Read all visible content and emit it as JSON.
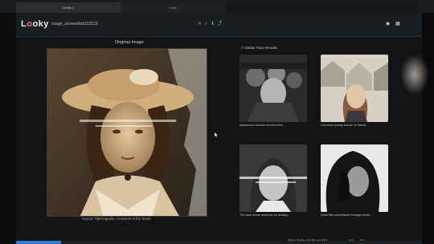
{
  "tabs": [
    {
      "label": "Detail 1"
    },
    {
      "label": "Links"
    }
  ],
  "app": {
    "logo_prefix": "L",
    "logo_o": "o",
    "logo_suffix": "oky",
    "image_label": "image_screenshot123123"
  },
  "toolbar": {
    "icons": [
      "close-icon",
      "check-icon",
      "download-icon",
      "share-icon",
      "settings-icon",
      "grid-icon"
    ]
  },
  "left_panel": {
    "title": "Original Image",
    "source": "Source: Titanicapedia / Survivors of the Titanic"
  },
  "results": {
    "title": "4 Similar Face Results",
    "items": [
      {
        "caption": "Mysterious Woman survives the..."
      },
      {
        "caption": "Unknown young woman is Salem..."
      },
      {
        "caption": "The best online resource for finding..."
      },
      {
        "caption": "Does this surveillance footage show..."
      }
    ]
  },
  "feedback": {
    "question": "Were these results useful?",
    "yes": "Yes",
    "no": "No"
  },
  "progress": {
    "fraction": 0.11
  },
  "colors": {
    "accent": "#f06aa3",
    "positive": "#3fbf73",
    "progress": "#2d7fd6"
  }
}
